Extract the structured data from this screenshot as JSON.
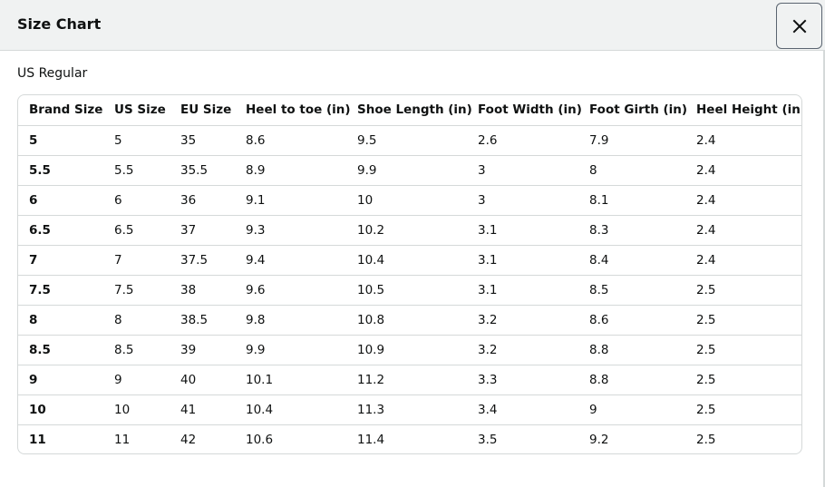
{
  "modal": {
    "title": "Size Chart",
    "close_icon": "close-icon"
  },
  "section": {
    "title": "US Regular"
  },
  "table": {
    "headers": [
      "Brand Size",
      "US Size",
      "EU Size",
      "Heel to toe (in)",
      "Shoe Length (in)",
      "Foot Width (in)",
      "Foot Girth (in)",
      "Heel Height (in)"
    ],
    "rows": [
      [
        "5",
        "5",
        "35",
        "8.6",
        "9.5",
        "2.6",
        "7.9",
        "2.4"
      ],
      [
        "5.5",
        "5.5",
        "35.5",
        "8.9",
        "9.9",
        "3",
        "8",
        "2.4"
      ],
      [
        "6",
        "6",
        "36",
        "9.1",
        "10",
        "3",
        "8.1",
        "2.4"
      ],
      [
        "6.5",
        "6.5",
        "37",
        "9.3",
        "10.2",
        "3.1",
        "8.3",
        "2.4"
      ],
      [
        "7",
        "7",
        "37.5",
        "9.4",
        "10.4",
        "3.1",
        "8.4",
        "2.4"
      ],
      [
        "7.5",
        "7.5",
        "38",
        "9.6",
        "10.5",
        "3.1",
        "8.5",
        "2.5"
      ],
      [
        "8",
        "8",
        "38.5",
        "9.8",
        "10.8",
        "3.2",
        "8.6",
        "2.5"
      ],
      [
        "8.5",
        "8.5",
        "39",
        "9.9",
        "10.9",
        "3.2",
        "8.8",
        "2.5"
      ],
      [
        "9",
        "9",
        "40",
        "10.1",
        "11.2",
        "3.3",
        "8.8",
        "2.5"
      ],
      [
        "10",
        "10",
        "41",
        "10.4",
        "11.3",
        "3.4",
        "9",
        "2.5"
      ],
      [
        "11",
        "11",
        "42",
        "10.6",
        "11.4",
        "3.5",
        "9.2",
        "2.5"
      ]
    ]
  }
}
